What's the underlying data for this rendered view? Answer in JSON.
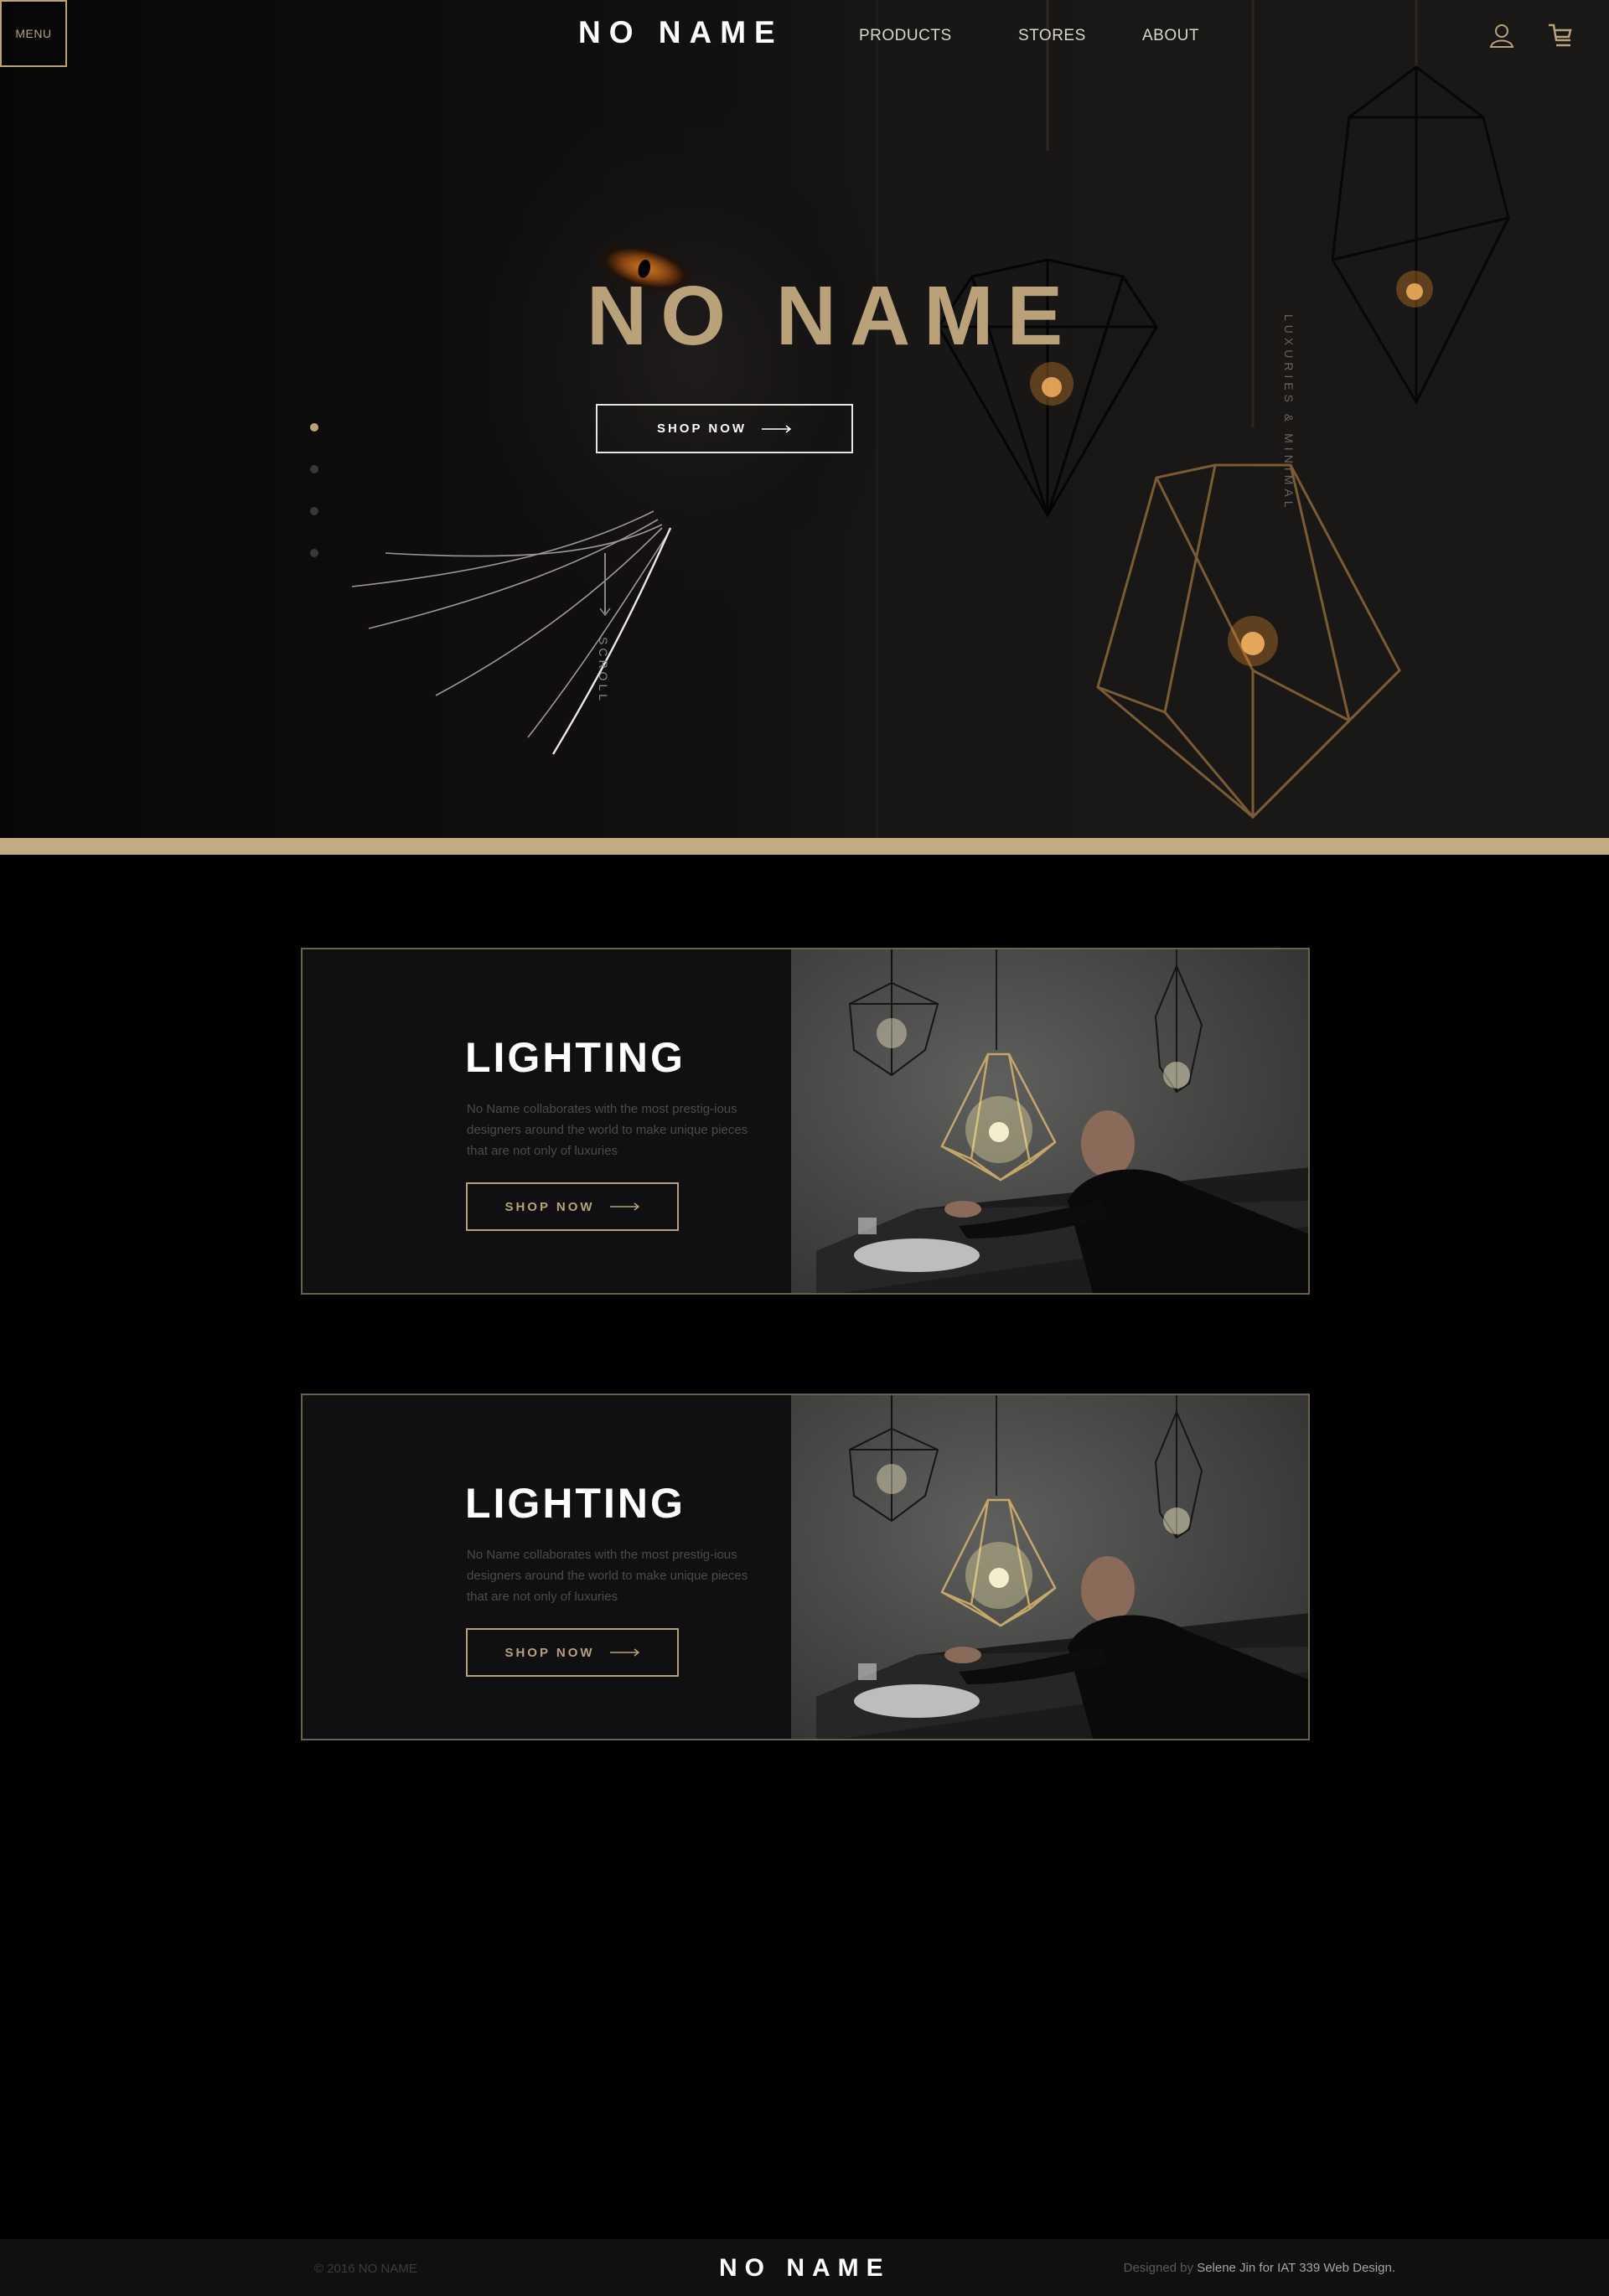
{
  "header": {
    "menu_label": "MENU",
    "logo": "NO NAME",
    "nav": [
      "PRODUCTS",
      "STORES",
      "ABOUT"
    ]
  },
  "hero": {
    "title": "NO NAME",
    "shop_label": "SHOP NOW",
    "scroll_label": "SCROLL",
    "side_tag": "LUXURIES & MINIMAL",
    "slides_total": 4,
    "slide_active": 1
  },
  "cards": [
    {
      "title": "LIGHTING",
      "text": "No Name collaborates with the most prestig-ious designers around the world to make unique pieces that are not only of luxuries",
      "button": "SHOP NOW"
    },
    {
      "title": "LIGHTING",
      "text": "No Name collaborates with the most prestig-ious designers around the world to make unique pieces that are not only of luxuries",
      "button": "SHOP NOW"
    }
  ],
  "footer": {
    "copyright": "© 2016 NO NAME",
    "logo": "NO NAME",
    "credit_prefix": "Designed by ",
    "credit_name": "Selene Jin for IAT 339 Web Design."
  },
  "colors": {
    "accent_gold": "#b9a27a",
    "background": "#000000",
    "card_bg": "#101012"
  },
  "icons": [
    "user-icon",
    "cart-icon",
    "arrow-right-icon"
  ]
}
